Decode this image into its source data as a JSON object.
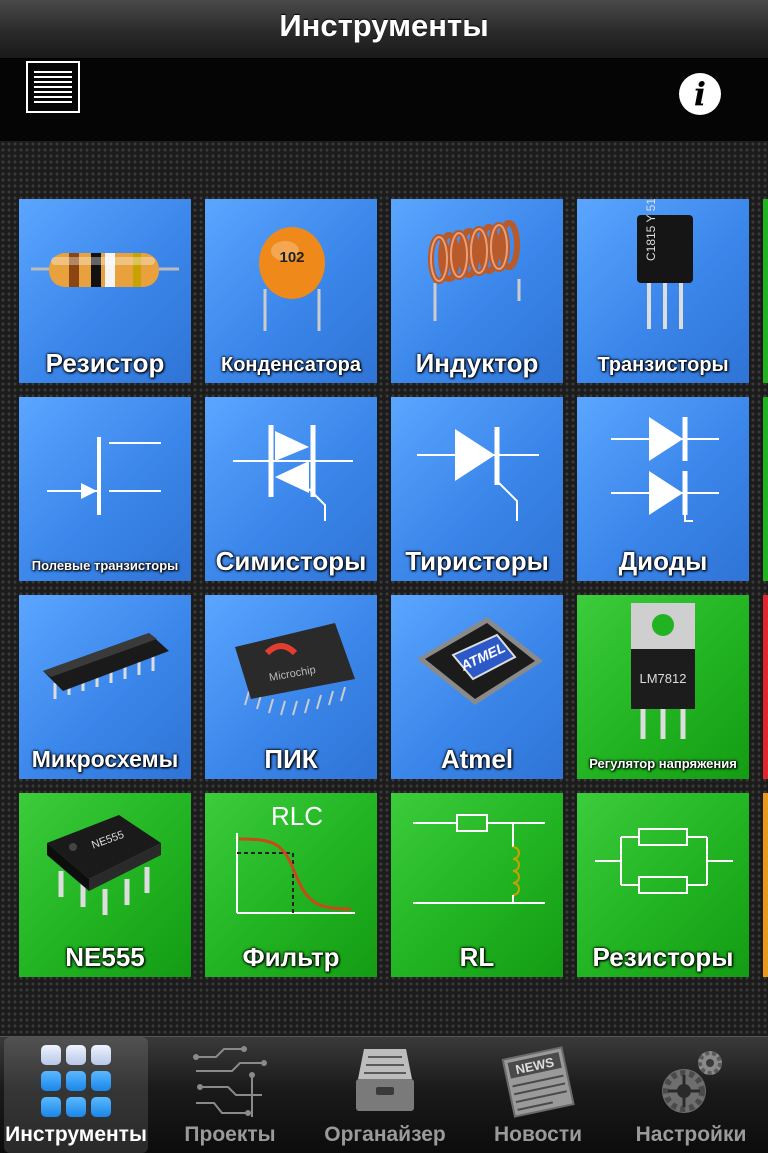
{
  "header": {
    "title": "Инструменты"
  },
  "tiles": [
    {
      "label": "Резистор",
      "icon": "resistor-icon"
    },
    {
      "label": "Конденсатора",
      "icon": "capacitor-icon",
      "marking": "102"
    },
    {
      "label": "Индуктор",
      "icon": "inductor-icon"
    },
    {
      "label": "Транзисторы",
      "icon": "transistor-icon",
      "marking": "C1815 Y 51"
    },
    {
      "label": "Полевые транзисторы",
      "icon": "fet-symbol-icon"
    },
    {
      "label": "Симисторы",
      "icon": "triac-symbol-icon"
    },
    {
      "label": "Тиристоры",
      "icon": "thyristor-symbol-icon"
    },
    {
      "label": "Диоды",
      "icon": "diode-symbol-icon"
    },
    {
      "label": "Микросхемы",
      "icon": "dip-chip-icon"
    },
    {
      "label": "ПИК",
      "icon": "pic-chip-icon",
      "marking": "Microchip"
    },
    {
      "label": "Atmel",
      "icon": "atmel-chip-icon",
      "marking": "ATMEL"
    },
    {
      "label": "Регулятор напряжения",
      "icon": "voltage-regulator-icon",
      "marking": "LM7812"
    },
    {
      "label": "NE555",
      "icon": "ne555-chip-icon",
      "marking": "NE555"
    },
    {
      "label": "Фильтр",
      "icon": "rlc-filter-graph-icon",
      "marking": "RLC"
    },
    {
      "label": "RL",
      "icon": "rl-circuit-icon"
    },
    {
      "label": "Резисторы",
      "icon": "parallel-resistors-icon"
    }
  ],
  "tabs": [
    {
      "label": "Инструменты",
      "icon": "grid-apps-icon",
      "active": true
    },
    {
      "label": "Проекты",
      "icon": "circuit-board-icon",
      "active": false
    },
    {
      "label": "Органайзер",
      "icon": "file-drawer-icon",
      "active": false
    },
    {
      "label": "Новости",
      "icon": "newspaper-icon",
      "active": false
    },
    {
      "label": "Настройки",
      "icon": "gears-icon",
      "active": false
    }
  ],
  "colors": {
    "tile_blue": "#3b86ea",
    "tile_green": "#21b321",
    "edge_red": "#e0262f",
    "edge_orange": "#e89a1a"
  }
}
